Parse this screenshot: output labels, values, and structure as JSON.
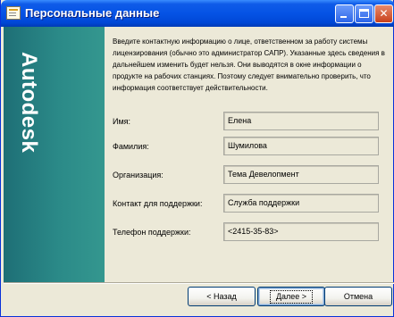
{
  "window": {
    "title": "Персональные данные"
  },
  "sidebar": {
    "brand": "Autodesk"
  },
  "intro_text": "Введите контактную информацию о лице, ответственном за работу системы лицензирования (обычно это администратор САПР). Указанные здесь сведения в дальнейшем изменить будет нельзя. Они выводятся в окне информации о продукте на рабочих станциях. Поэтому следует внимательно проверить, что информация соответствует действительности.",
  "fields": [
    {
      "label": "Имя:",
      "value": "Елена"
    },
    {
      "label": "Фамилия:",
      "value": "Шумилова"
    },
    {
      "label": "Организация:",
      "value": "Тема Девелопмент"
    },
    {
      "label": "Контакт для поддержки:",
      "value": "Служба поддержки"
    },
    {
      "label": "Телефон поддержки:",
      "value": "<2415-35-83>"
    }
  ],
  "buttons": {
    "back": "< Назад",
    "next": "Далее >",
    "cancel": "Отмена"
  },
  "colors": {
    "titlebar": "#0553e5",
    "sidebar": "#2b8a88",
    "dialog_bg": "#ece9d8"
  }
}
